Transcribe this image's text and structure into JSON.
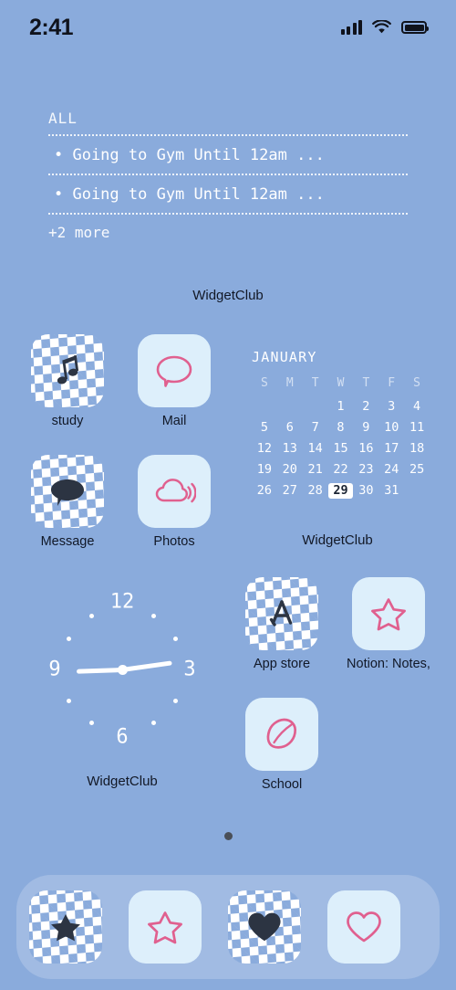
{
  "status_bar": {
    "time": "2:41",
    "cellular_icon": "signal-bars-icon",
    "wifi_icon": "wifi-icon",
    "battery_icon": "battery-icon"
  },
  "reminders_widget": {
    "title": "ALL",
    "items": [
      "• Going to Gym Until 12am ...",
      "• Going to Gym Until 12am ..."
    ],
    "more": "+2 more",
    "label": "WidgetClub"
  },
  "calendar_widget": {
    "month": "JANUARY",
    "weekdays": [
      "S",
      "M",
      "T",
      "W",
      "T",
      "F",
      "S"
    ],
    "leading_blanks": 3,
    "days": [
      1,
      2,
      3,
      4,
      5,
      6,
      7,
      8,
      9,
      10,
      11,
      12,
      13,
      14,
      15,
      16,
      17,
      18,
      19,
      20,
      21,
      22,
      23,
      24,
      25,
      26,
      27,
      28,
      29,
      30,
      31
    ],
    "today": 29,
    "label": "WidgetClub"
  },
  "clock_widget": {
    "numerals": [
      "12",
      "3",
      "6",
      "9"
    ],
    "hour_angle_deg": 82,
    "minute_angle_deg": 268,
    "label": "WidgetClub"
  },
  "apps": [
    {
      "name": "study",
      "label": "study",
      "style": "checker",
      "icon": "music-note-icon"
    },
    {
      "name": "mail",
      "label": "Mail",
      "style": "pastel",
      "icon": "speech-bubble-icon"
    },
    {
      "name": "message",
      "label": "Message",
      "style": "checker",
      "icon": "speech-bubble-filled-icon"
    },
    {
      "name": "photos",
      "label": "Photos",
      "style": "pastel",
      "icon": "cloud-sound-icon"
    },
    {
      "name": "app-store",
      "label": "App store",
      "style": "checker",
      "icon": "app-store-a-icon"
    },
    {
      "name": "notion-notes",
      "label": "Notion: Notes,",
      "style": "pastel",
      "icon": "star-outline-icon"
    },
    {
      "name": "school",
      "label": "School",
      "style": "pastel",
      "icon": "lemon-outline-icon"
    }
  ],
  "dock": [
    {
      "name": "dock-star-checker",
      "style": "checker",
      "icon": "star-filled-icon"
    },
    {
      "name": "dock-star-pastel",
      "style": "pastel",
      "icon": "star-outline-icon"
    },
    {
      "name": "dock-heart-checker",
      "style": "checker",
      "icon": "heart-filled-icon"
    },
    {
      "name": "dock-heart-pastel",
      "style": "pastel",
      "icon": "heart-outline-icon"
    }
  ],
  "page_indicator": {
    "total": 1,
    "current": 1
  },
  "colors": {
    "wallpaper": "#8aabdc",
    "pastel_tile": "#ddeffb",
    "accent_pink": "#e0608f",
    "glyph_dark": "#2c3442",
    "label_text": "#111827",
    "widget_text": "#ffffff"
  }
}
